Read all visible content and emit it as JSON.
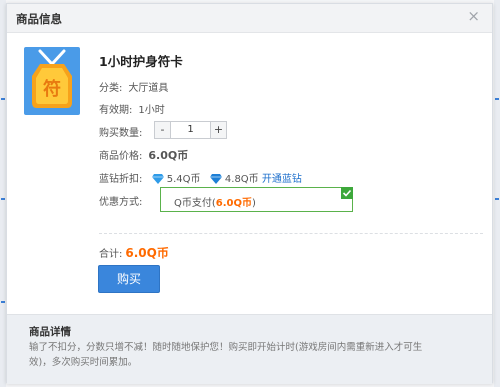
{
  "dialog": {
    "title": "商品信息",
    "close_glyph": "×"
  },
  "product": {
    "icon": "amulet-card-icon",
    "icon_glyph": "符",
    "name": "1小时护身符卡",
    "category_label": "分类:",
    "category_value": "大厅道具",
    "validity_label": "有效期:",
    "validity_value": "1小时",
    "quantity_label": "购买数量:",
    "quantity_value": "1",
    "minus_glyph": "-",
    "plus_glyph": "+",
    "price_label": "商品价格:",
    "price_value": "6.0Q币",
    "diamond_label": "蓝钻折扣:",
    "diamond_price_1": "5.4Q币",
    "diamond_price_2": "4.8Q币",
    "open_diamond_link": "开通蓝钻",
    "payment_label": "优惠方式:",
    "payment_prefix": "Q币支付(",
    "payment_amount": "6.0Q币",
    "payment_suffix": ")"
  },
  "checkout": {
    "total_label": "合计:",
    "total_value": "6.0Q币",
    "buy_label": "购买"
  },
  "details": {
    "title": "商品详情",
    "text": "输了不扣分，分数只增不减！随时随地保护您！购买即开始计时(游戏房间内需重新进入才可生效)，多次购买时间累加。"
  },
  "colors": {
    "accent": "#3a86dc",
    "price": "#ff6a00",
    "selected": "#5ab24b",
    "link": "#1d6fcc"
  }
}
